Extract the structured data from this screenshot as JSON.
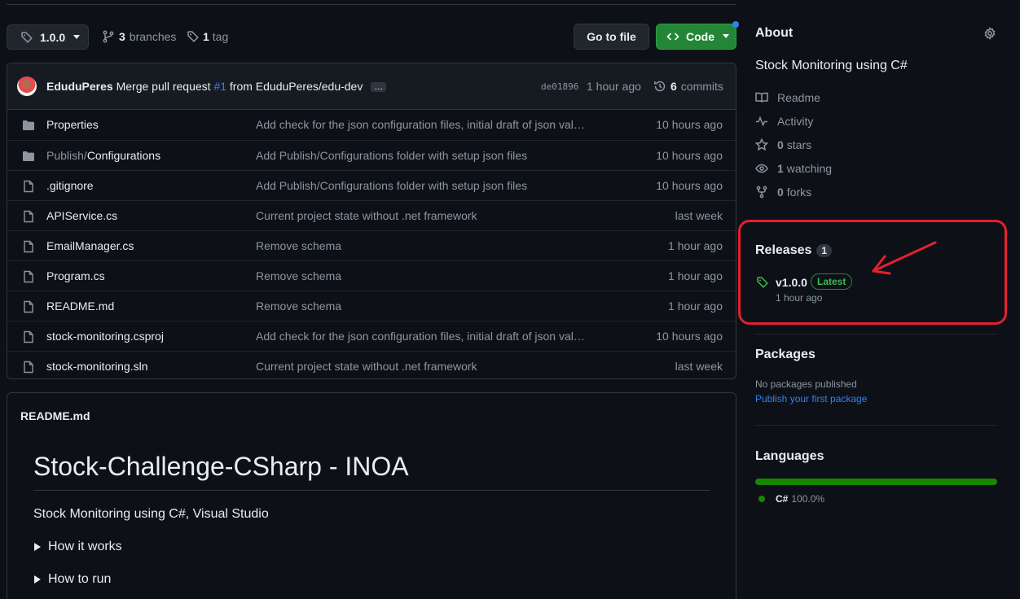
{
  "toolbar": {
    "tag_selector": "1.0.0",
    "branches_count": "3",
    "branches_label": "branches",
    "tags_count": "1",
    "tags_label": "tag",
    "go_to_file": "Go to file",
    "code": "Code"
  },
  "commit": {
    "author": "EduduPeres",
    "message_prefix": "Merge pull request",
    "pr_link": "#1",
    "message_suffix": "from EduduPeres/edu-dev",
    "more": "…",
    "sha": "de01896",
    "time": "1 hour ago",
    "commits_count": "6",
    "commits_label": "commits"
  },
  "files": [
    {
      "type": "dir",
      "name": "Properties",
      "message": "Add check for the json configuration files, initial draft of json val…",
      "date": "10 hours ago"
    },
    {
      "type": "dir",
      "name_prefix": "Publish/",
      "name": "Configurations",
      "message": "Add Publish/Configurations folder with setup json files",
      "date": "10 hours ago"
    },
    {
      "type": "file",
      "name": ".gitignore",
      "message": "Add Publish/Configurations folder with setup json files",
      "date": "10 hours ago"
    },
    {
      "type": "file",
      "name": "APIService.cs",
      "message": "Current project state without .net framework",
      "date": "last week"
    },
    {
      "type": "file",
      "name": "EmailManager.cs",
      "message": "Remove schema",
      "date": "1 hour ago"
    },
    {
      "type": "file",
      "name": "Program.cs",
      "message": "Remove schema",
      "date": "1 hour ago"
    },
    {
      "type": "file",
      "name": "README.md",
      "message": "Remove schema",
      "date": "1 hour ago"
    },
    {
      "type": "file",
      "name": "stock-monitoring.csproj",
      "message": "Add check for the json configuration files, initial draft of json val…",
      "date": "10 hours ago"
    },
    {
      "type": "file",
      "name": "stock-monitoring.sln",
      "message": "Current project state without .net framework",
      "date": "last week"
    }
  ],
  "readme": {
    "file_label": "README.md",
    "heading": "Stock-Challenge-CSharp - INOA",
    "description": "Stock Monitoring using C#, Visual Studio",
    "sections": [
      "How it works",
      "How to run"
    ]
  },
  "about": {
    "title": "About",
    "description": "Stock Monitoring using C#",
    "readme": "Readme",
    "activity": "Activity",
    "stars_count": "0",
    "stars_label": "stars",
    "watching_count": "1",
    "watching_label": "watching",
    "forks_count": "0",
    "forks_label": "forks"
  },
  "releases": {
    "title": "Releases",
    "count": "1",
    "version": "v1.0.0",
    "badge": "Latest",
    "time": "1 hour ago"
  },
  "packages": {
    "title": "Packages",
    "empty": "No packages published",
    "link": "Publish your first package"
  },
  "languages": {
    "title": "Languages",
    "items": [
      {
        "name": "C#",
        "percent": "100.0%",
        "fraction": 1.0,
        "color": "#178600"
      }
    ]
  },
  "colors": {
    "accent_green": "#238636",
    "link_blue": "#2f81f7",
    "annotation_red": "#e5202e"
  }
}
